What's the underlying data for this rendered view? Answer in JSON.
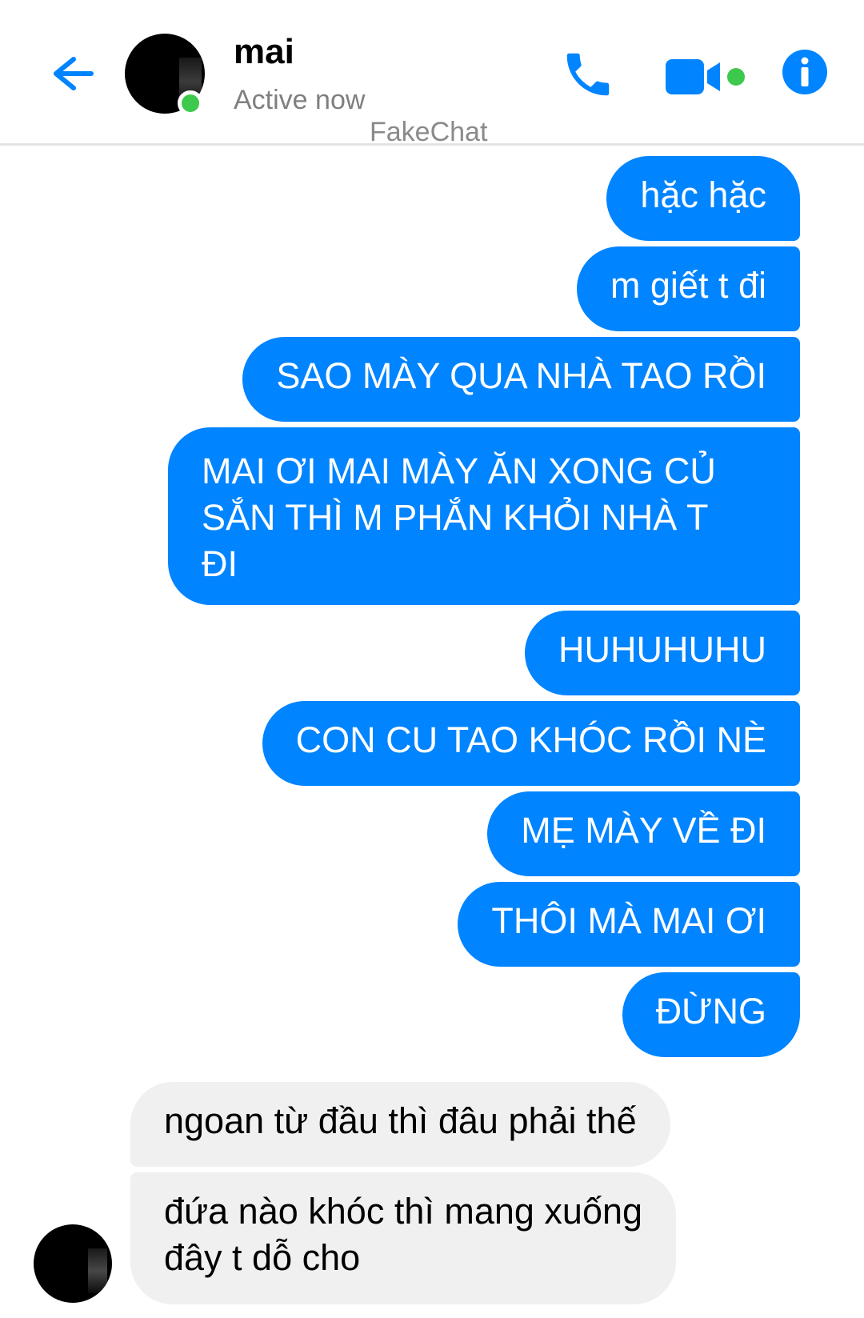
{
  "header": {
    "contact_name": "mai",
    "status": "Active now",
    "watermark": "FakeChat",
    "back_icon": "back-arrow-icon",
    "call_icon": "phone-icon",
    "video_icon": "video-camera-icon",
    "info_icon": "info-icon",
    "accent_color": "#0084ff",
    "active_color": "#3dc94b"
  },
  "messages": {
    "outgoing": [
      "hặc hặc",
      "m giết t đi",
      "SAO MÀY QUA NHÀ TAO RỒI",
      "MAI ƠI MAI MÀY ĂN XONG CỦ\nSẮN THÌ M PHẮN KHỎI NHÀ T\nĐI",
      "HUHUHUHU",
      "CON CU TAO KHÓC RỒI NÈ",
      "MẸ MÀY VỀ ĐI",
      "THÔI MÀ MAI ƠI",
      "ĐỪNG"
    ],
    "incoming": [
      "ngoan từ đầu thì đâu phải thế",
      "đứa nào khóc thì mang xuống\nđây t dỗ cho"
    ],
    "outgoing_color": "#0084ff",
    "incoming_color": "#f1f0f0"
  }
}
